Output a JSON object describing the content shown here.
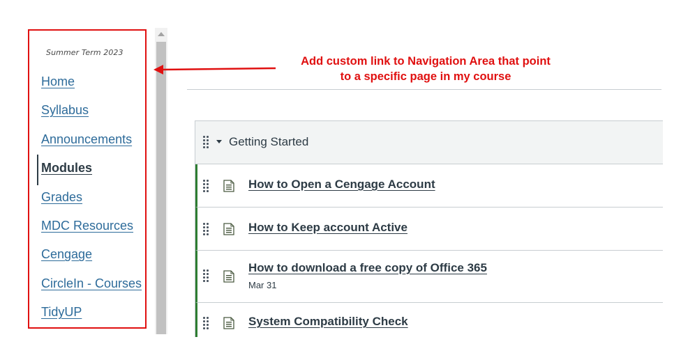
{
  "sidebar": {
    "term": "Summer Term 2023",
    "items": [
      {
        "label": "Home"
      },
      {
        "label": "Syllabus"
      },
      {
        "label": "Announcements"
      },
      {
        "label": "Modules",
        "active": true
      },
      {
        "label": "Grades"
      },
      {
        "label": "MDC Resources"
      },
      {
        "label": "Cengage"
      },
      {
        "label": "CircleIn - Courses"
      },
      {
        "label": "TidyUP"
      }
    ]
  },
  "annotation": {
    "line1": "Add custom link to Navigation Area that point",
    "line2": "to a specific page in my course",
    "color": "#e01010"
  },
  "module": {
    "title": "Getting Started",
    "items": [
      {
        "title": "How to Open a Cengage Account",
        "date": ""
      },
      {
        "title": "How to Keep account Active",
        "date": ""
      },
      {
        "title": "How to download a free copy of Office 365",
        "date": "Mar 31"
      },
      {
        "title": "System Compatibility Check",
        "date": ""
      }
    ]
  },
  "colors": {
    "link": "#2d6b9a",
    "text": "#2d3b45",
    "highlight_border": "#e01010",
    "published_bar": "#2e7d32",
    "header_bg": "#f2f4f4"
  },
  "icons": [
    "drag-handle-icon",
    "caret-down-icon",
    "page-icon",
    "arrow-left-icon"
  ]
}
